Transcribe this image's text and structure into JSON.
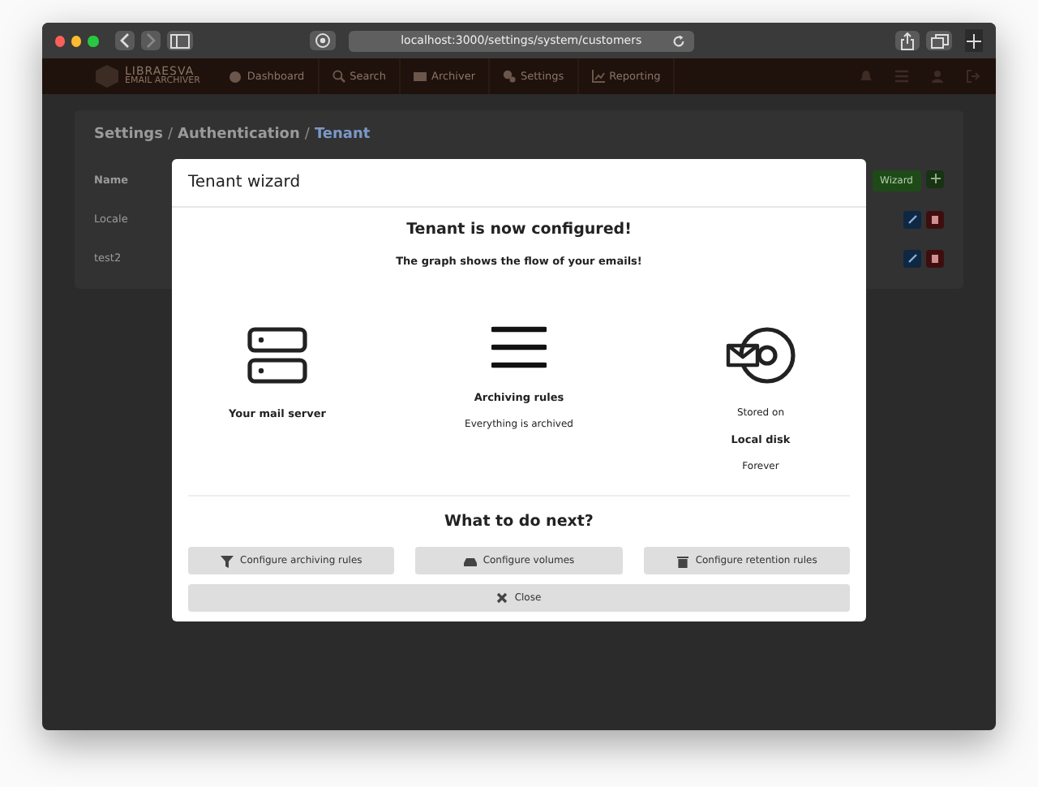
{
  "browser": {
    "url": "localhost:3000/settings/system/customers"
  },
  "nav": {
    "logo_line1": "LIBRAESVA",
    "logo_line2": "EMAIL ARCHIVER",
    "items": [
      {
        "label": "Dashboard"
      },
      {
        "label": "Search"
      },
      {
        "label": "Archiver"
      },
      {
        "label": "Settings"
      },
      {
        "label": "Reporting"
      }
    ]
  },
  "page": {
    "breadcrumb": [
      {
        "text": "Settings",
        "current": false
      },
      {
        "text": "Authentication",
        "current": false
      },
      {
        "text": "Tenant",
        "current": true
      }
    ],
    "breadcrumb_separators": [
      "/",
      "/"
    ],
    "column": "Name",
    "rows": [
      "Locale",
      "test2"
    ],
    "wizard_button": "Wizard"
  },
  "modal": {
    "title": "Tenant wizard",
    "heading": "Tenant is now configured!",
    "subheading": "The graph shows the flow of your emails!",
    "nodes": [
      {
        "kind": "server",
        "lines": [
          {
            "text": "Your mail server",
            "bold": true
          }
        ]
      },
      {
        "kind": "rules",
        "lines": [
          {
            "text": "Archiving rules",
            "bold": true
          },
          {
            "text": "Everything is archived",
            "bold": false
          }
        ]
      },
      {
        "kind": "storage",
        "lines": [
          {
            "text": "Stored on",
            "bold": false
          },
          {
            "text": "Local disk",
            "bold": true
          },
          {
            "text": "Forever",
            "bold": false
          }
        ]
      }
    ],
    "next_heading": "What to do next?",
    "actions": [
      {
        "label": "Configure archiving rules"
      },
      {
        "label": "Configure volumes"
      },
      {
        "label": "Configure retention rules"
      }
    ],
    "close_button": "Close"
  }
}
